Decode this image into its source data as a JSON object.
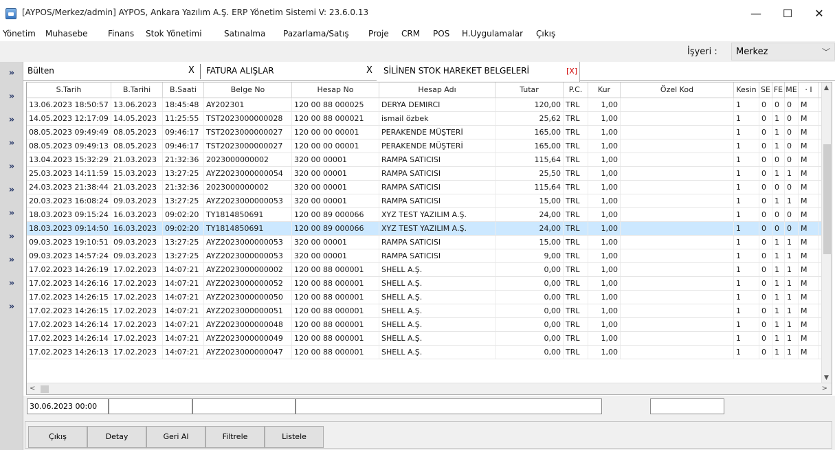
{
  "window": {
    "title": "[AYPOS/Merkez/admin] AYPOS, Ankara Yazılım A.Ş. ERP Yönetim Sistemi V: 23.6.0.13",
    "min_glyph": "—",
    "max_glyph": "☐",
    "close_glyph": "✕"
  },
  "menu": [
    "Yönetim",
    "Muhasebe",
    "Finans",
    "Stok Yönetimi",
    "Satınalma",
    "Pazarlama/Satış",
    "Proje",
    "CRM",
    "POS",
    "H.Uygulamalar",
    "Çıkış"
  ],
  "workplace": {
    "label": "İşyeri :",
    "value": "Merkez"
  },
  "gutter_glyph": "»",
  "tabs": [
    {
      "label": "Bülten",
      "close": "X"
    },
    {
      "label": "FATURA ALIŞLAR",
      "close": "X"
    },
    {
      "label": "SİLİNEN STOK HAREKET BELGELERİ",
      "close": "[X]"
    }
  ],
  "grid": {
    "headers": [
      "S.Tarih",
      "B.Tarihi",
      "B.Saati",
      "Belge No",
      "Hesap No",
      "Hesap Adı",
      "Tutar",
      "P.C.",
      "Kur",
      "Özel Kod",
      "Kesin",
      "SE",
      "FE",
      "ME",
      "· I"
    ],
    "rows": [
      [
        "13.06.2023 18:50:57",
        "13.06.2023",
        "18:45:48",
        "AY202301",
        "120 00 88 000025",
        "DERYA DEMIRCI",
        "120,00",
        "TRL",
        "1,00",
        "",
        "1",
        "0",
        "0",
        "0",
        "M"
      ],
      [
        "14.05.2023 12:17:09",
        "14.05.2023",
        "11:25:55",
        "TST2023000000028",
        "120 00 88 000021",
        "ismail özbek",
        "25,62",
        "TRL",
        "1,00",
        "",
        "1",
        "0",
        "1",
        "0",
        "M"
      ],
      [
        "08.05.2023 09:49:49",
        "08.05.2023",
        "09:46:17",
        "TST2023000000027",
        "120 00 00 00001",
        "PERAKENDE MÜŞTERİ",
        "165,00",
        "TRL",
        "1,00",
        "",
        "1",
        "0",
        "1",
        "0",
        "M"
      ],
      [
        "08.05.2023 09:49:13",
        "08.05.2023",
        "09:46:17",
        "TST2023000000027",
        "120 00 00 00001",
        "PERAKENDE MÜŞTERİ",
        "165,00",
        "TRL",
        "1,00",
        "",
        "1",
        "0",
        "1",
        "0",
        "M"
      ],
      [
        "13.04.2023 15:32:29",
        "21.03.2023",
        "21:32:36",
        "2023000000002",
        "320 00 00001",
        "RAMPA SATICISI",
        "115,64",
        "TRL",
        "1,00",
        "",
        "1",
        "0",
        "0",
        "0",
        "M"
      ],
      [
        "25.03.2023 14:11:59",
        "15.03.2023",
        "13:27:25",
        "AYZ2023000000054",
        "320 00 00001",
        "RAMPA SATICISI",
        "25,50",
        "TRL",
        "1,00",
        "",
        "1",
        "0",
        "1",
        "1",
        "M"
      ],
      [
        "24.03.2023 21:38:44",
        "21.03.2023",
        "21:32:36",
        "2023000000002",
        "320 00 00001",
        "RAMPA SATICISI",
        "115,64",
        "TRL",
        "1,00",
        "",
        "1",
        "0",
        "0",
        "0",
        "M"
      ],
      [
        "20.03.2023 16:08:24",
        "09.03.2023",
        "13:27:25",
        "AYZ2023000000053",
        "320 00 00001",
        "RAMPA SATICISI",
        "15,00",
        "TRL",
        "1,00",
        "",
        "1",
        "0",
        "1",
        "1",
        "M"
      ],
      [
        "18.03.2023 09:15:24",
        "16.03.2023",
        "09:02:20",
        "TY1814850691",
        "120 00 89 000066",
        "XYZ TEST YAZILIM A.Ş.",
        "24,00",
        "TRL",
        "1,00",
        "",
        "1",
        "0",
        "0",
        "0",
        "M"
      ],
      [
        "18.03.2023 09:14:50",
        "16.03.2023",
        "09:02:20",
        "TY1814850691",
        "120 00 89 000066",
        "XYZ TEST YAZILIM A.Ş.",
        "24,00",
        "TRL",
        "1,00",
        "",
        "1",
        "0",
        "0",
        "0",
        "M"
      ],
      [
        "09.03.2023 19:10:51",
        "09.03.2023",
        "13:27:25",
        "AYZ2023000000053",
        "320 00 00001",
        "RAMPA SATICISI",
        "15,00",
        "TRL",
        "1,00",
        "",
        "1",
        "0",
        "1",
        "1",
        "M"
      ],
      [
        "09.03.2023 14:57:24",
        "09.03.2023",
        "13:27:25",
        "AYZ2023000000053",
        "320 00 00001",
        "RAMPA SATICISI",
        "9,00",
        "TRL",
        "1,00",
        "",
        "1",
        "0",
        "1",
        "1",
        "M"
      ],
      [
        "17.02.2023 14:26:19",
        "17.02.2023",
        "14:07:21",
        "AYZ2023000000002",
        "120 00 88 000001",
        "SHELL A.Ş.",
        "0,00",
        "TRL",
        "1,00",
        "",
        "1",
        "0",
        "1",
        "1",
        "M"
      ],
      [
        "17.02.2023 14:26:16",
        "17.02.2023",
        "14:07:21",
        "AYZ2023000000052",
        "120 00 88 000001",
        "SHELL A.Ş.",
        "0,00",
        "TRL",
        "1,00",
        "",
        "1",
        "0",
        "1",
        "1",
        "M"
      ],
      [
        "17.02.2023 14:26:15",
        "17.02.2023",
        "14:07:21",
        "AYZ2023000000050",
        "120 00 88 000001",
        "SHELL A.Ş.",
        "0,00",
        "TRL",
        "1,00",
        "",
        "1",
        "0",
        "1",
        "1",
        "M"
      ],
      [
        "17.02.2023 14:26:15",
        "17.02.2023",
        "14:07:21",
        "AYZ2023000000051",
        "120 00 88 000001",
        "SHELL A.Ş.",
        "0,00",
        "TRL",
        "1,00",
        "",
        "1",
        "0",
        "1",
        "1",
        "M"
      ],
      [
        "17.02.2023 14:26:14",
        "17.02.2023",
        "14:07:21",
        "AYZ2023000000048",
        "120 00 88 000001",
        "SHELL A.Ş.",
        "0,00",
        "TRL",
        "1,00",
        "",
        "1",
        "0",
        "1",
        "1",
        "M"
      ],
      [
        "17.02.2023 14:26:14",
        "17.02.2023",
        "14:07:21",
        "AYZ2023000000049",
        "120 00 88 000001",
        "SHELL A.Ş.",
        "0,00",
        "TRL",
        "1,00",
        "",
        "1",
        "0",
        "1",
        "1",
        "M"
      ],
      [
        "17.02.2023 14:26:13",
        "17.02.2023",
        "14:07:21",
        "AYZ2023000000047",
        "120 00 88 000001",
        "SHELL A.Ş.",
        "0,00",
        "TRL",
        "1,00",
        "",
        "1",
        "0",
        "1",
        "1",
        "M"
      ]
    ],
    "selected_row": 9,
    "selection_color": "#cce8ff"
  },
  "filters": {
    "date_value": "30.06.2023 00:00"
  },
  "buttons": [
    "Çıkış",
    "Detay",
    "Geri Al",
    "Filtrele",
    "Listele"
  ],
  "colors": {
    "tab_close_red": "#d00000",
    "gutter_text": "#2a3a6a"
  }
}
